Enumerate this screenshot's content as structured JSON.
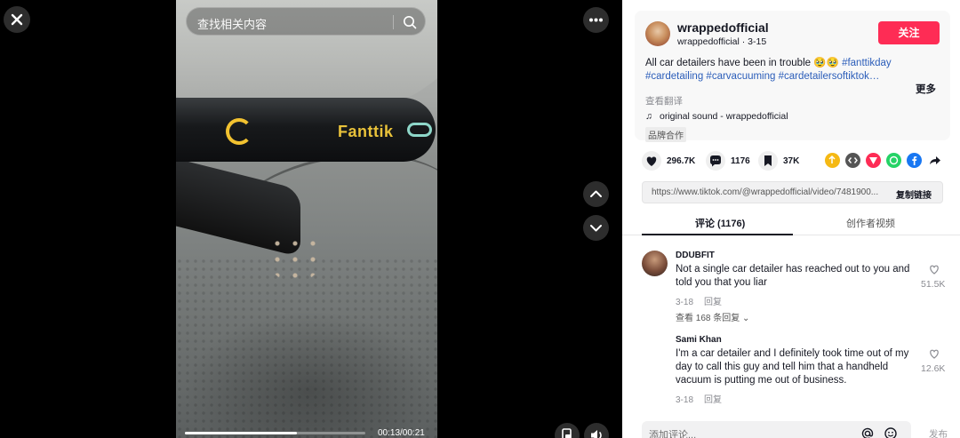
{
  "search": {
    "placeholder": "查找相关内容"
  },
  "video": {
    "brand_text": "Fanttik",
    "progress_fraction": 0.62,
    "time": "00:13/00:21"
  },
  "author": {
    "name": "wrappedofficial",
    "meta": "wrappedofficial · 3-15",
    "follow_label": "关注"
  },
  "caption": {
    "text": "All car detailers have been in trouble 🥹🥹 ",
    "tags": [
      "#fanttikday",
      "#cardetailing",
      "#carvacuuming",
      "#cardetailersoftiktok…"
    ],
    "more_label": "更多",
    "translate_label": "查看翻译"
  },
  "sound": {
    "label": "original sound - wrappedofficial"
  },
  "brand_tag": "品牌合作",
  "stats": {
    "likes": "296.7K",
    "comments": "1176",
    "saves": "37K"
  },
  "share_colors": [
    "#f5b914",
    "#555555",
    "#fe2c55",
    "#25d366",
    "#1877f2"
  ],
  "link": {
    "url": "https://www.tiktok.com/@wrappedofficial/video/7481900...",
    "copy_label": "复制链接"
  },
  "tabs": {
    "comments": "评论 (1176)",
    "creator_videos": "创作者视频"
  },
  "comments": [
    {
      "user": "DDUBFIT",
      "text": "Not a single car detailer has reached out to you and told you that you liar",
      "date": "3-18",
      "reply_label": "回复",
      "likes": "51.5K",
      "view_replies": "查看 168 条回复"
    },
    {
      "user": "Sami Khan",
      "text": "I'm a car detailer and I definitely took time out of my day to call this guy and tell him that a handheld vacuum is putting me out of business.",
      "date": "3-18",
      "reply_label": "回复",
      "likes": "12.6K"
    }
  ],
  "comment_box": {
    "placeholder": "添加评论...",
    "post_label": "发布"
  },
  "accent": {
    "primary": "#fe2c55",
    "link": "#2b5db9"
  }
}
